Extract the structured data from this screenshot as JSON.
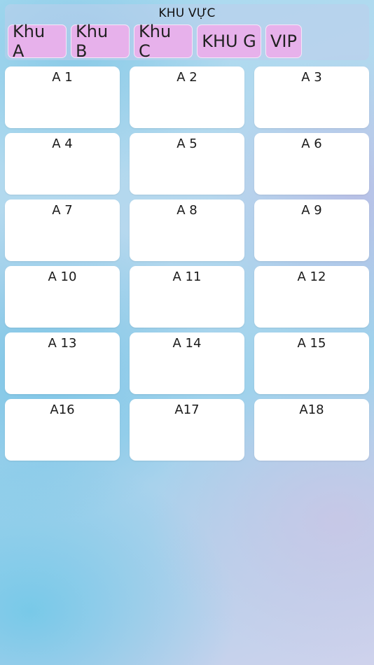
{
  "header": {
    "title": "KHU VỰC",
    "tabs": [
      {
        "label": "Khu A"
      },
      {
        "label": "Khu B"
      },
      {
        "label": "Khu C"
      },
      {
        "label": "KHU G"
      },
      {
        "label": "VIP"
      }
    ]
  },
  "tables": [
    {
      "label": "A 1"
    },
    {
      "label": "A 2"
    },
    {
      "label": "A 3"
    },
    {
      "label": "A 4"
    },
    {
      "label": "A 5"
    },
    {
      "label": "A 6"
    },
    {
      "label": "A 7"
    },
    {
      "label": "A 8"
    },
    {
      "label": "A 9"
    },
    {
      "label": "A 10"
    },
    {
      "label": "A 11"
    },
    {
      "label": "A 12"
    },
    {
      "label": "A 13"
    },
    {
      "label": "A 14"
    },
    {
      "label": "A 15"
    },
    {
      "label": "A16"
    },
    {
      "label": "A17"
    },
    {
      "label": "A18"
    }
  ],
  "colors": {
    "tab_background": "#e7b1eb",
    "card_background": "#ffffff"
  }
}
